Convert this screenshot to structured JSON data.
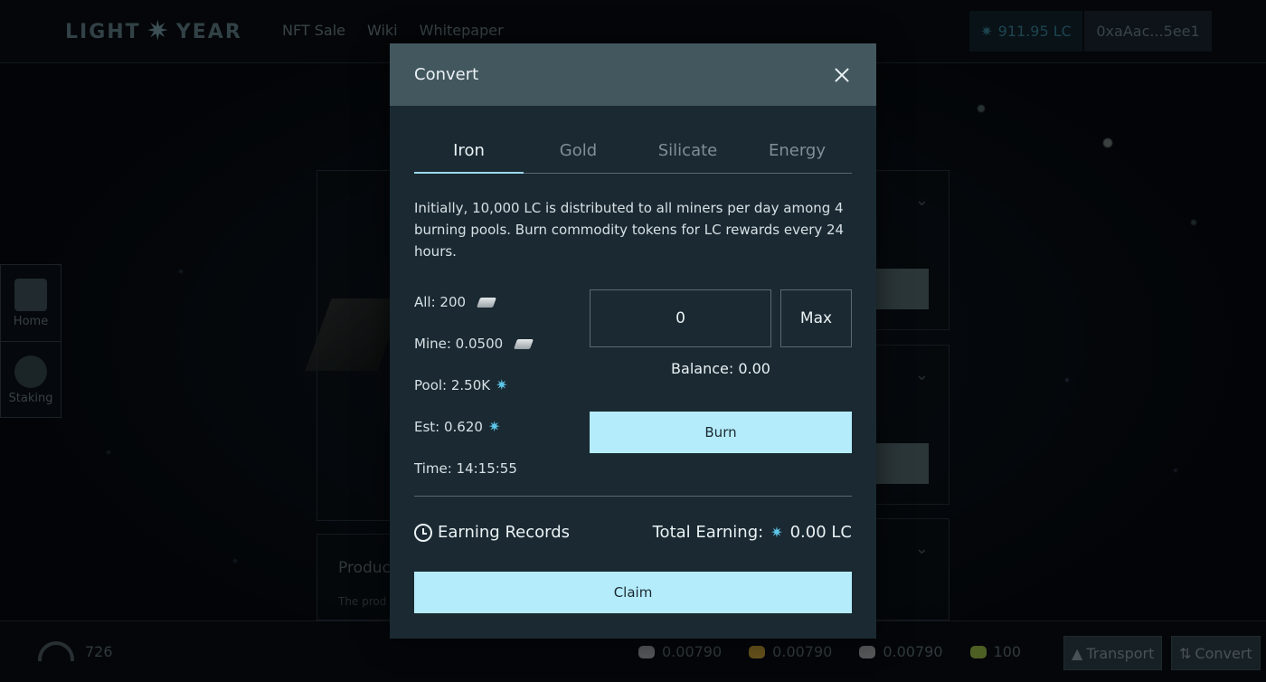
{
  "header": {
    "logo_left": "LIGHT",
    "logo_right": "YEAR",
    "nav": [
      "NFT Sale",
      "Wiki",
      "Whitepaper"
    ],
    "lc_balance": "911.95 LC",
    "address": "0xaAac...5ee1"
  },
  "sidebar": {
    "items": [
      {
        "label": "Home"
      },
      {
        "label": "Staking"
      }
    ]
  },
  "background": {
    "product_title": "Produc",
    "product_desc": "The prod"
  },
  "footer": {
    "speed": "726",
    "resources": [
      {
        "name": "iron",
        "value": "0.00790",
        "color": "#8a8f92"
      },
      {
        "name": "gold",
        "value": "0.00790",
        "color": "#a8862e"
      },
      {
        "name": "silicate",
        "value": "0.00790",
        "color": "#8d9194"
      },
      {
        "name": "energy",
        "value": "100",
        "color": "#7f9a3a"
      }
    ],
    "transport_label": "Transport",
    "convert_label": "Convert"
  },
  "modal": {
    "title": "Convert",
    "tabs": [
      "Iron",
      "Gold",
      "Silicate",
      "Energy"
    ],
    "active_tab": "Iron",
    "description": "Initially, 10,000 LC is distributed to all miners per day among 4 burning pools. Burn commodity tokens for LC rewards every 24 hours.",
    "stats": {
      "all": "All: 200",
      "mine": "Mine: 0.0500",
      "pool": "Pool: 2.50K",
      "est": "Est: 0.620",
      "time": "Time: 14:15:55"
    },
    "amount_value": "0",
    "max_label": "Max",
    "balance_label": "Balance:",
    "balance_value": "0.00",
    "burn_label": "Burn",
    "records_label": "Earning Records",
    "total_label": "Total Earning:",
    "total_value": "0.00 LC",
    "claim_label": "Claim"
  },
  "colors": {
    "accent": "#b5ecfb",
    "modal_bg": "#1a2932",
    "modal_header": "#43575f",
    "lc_icon": "#5cc6e8"
  }
}
